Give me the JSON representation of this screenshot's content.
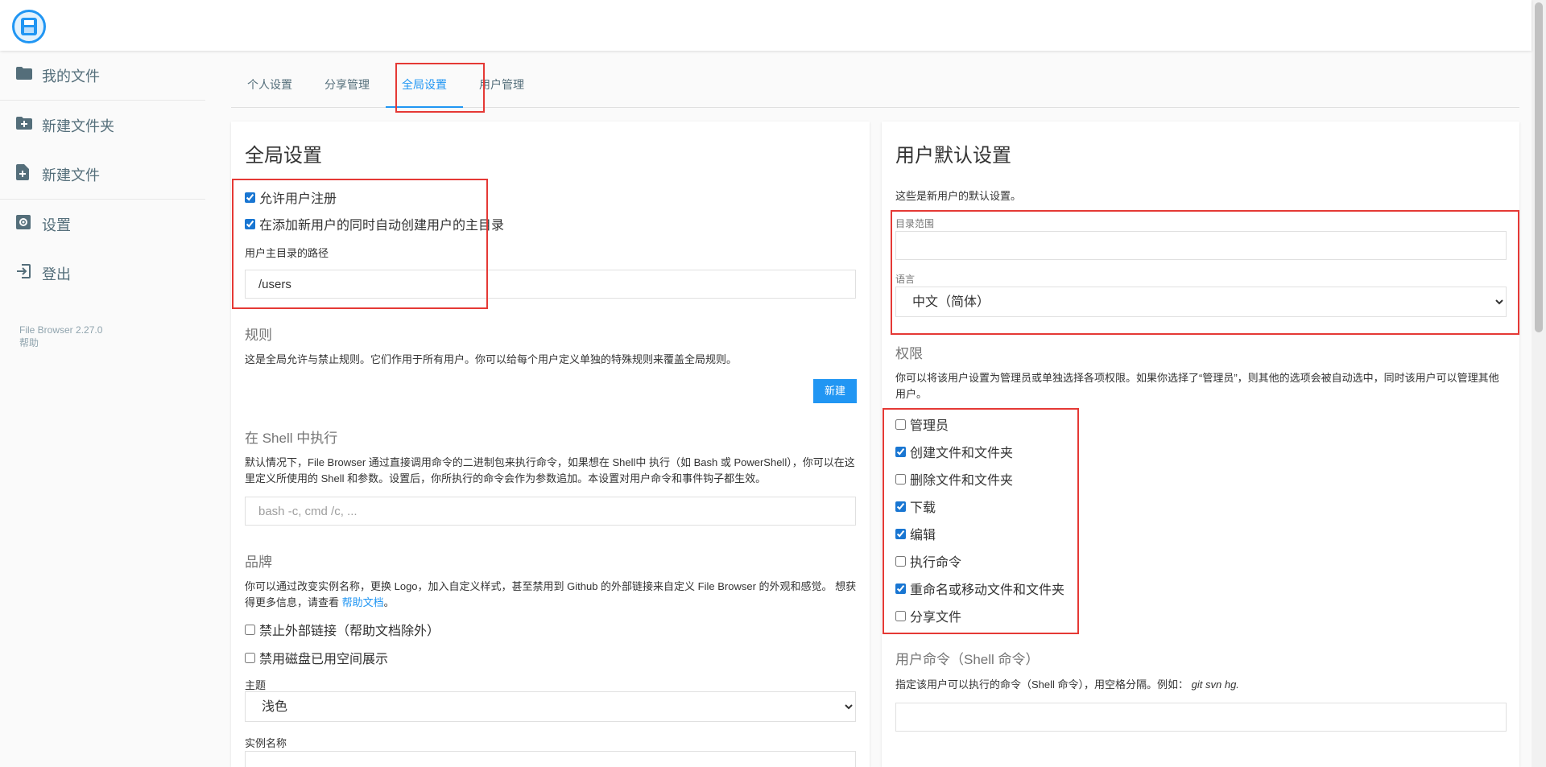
{
  "sidebar": {
    "items": [
      {
        "label": "我的文件",
        "icon": "folder-icon"
      },
      {
        "label": "新建文件夹",
        "icon": "folder-plus-icon"
      },
      {
        "label": "新建文件",
        "icon": "file-plus-icon"
      },
      {
        "label": "设置",
        "icon": "gear-icon"
      },
      {
        "label": "登出",
        "icon": "logout-icon"
      }
    ],
    "version": "File Browser 2.27.0",
    "help": "帮助"
  },
  "tabs": [
    {
      "label": "个人设置"
    },
    {
      "label": "分享管理"
    },
    {
      "label": "全局设置",
      "active": true
    },
    {
      "label": "用户管理"
    }
  ],
  "global": {
    "title": "全局设置",
    "allow_signup": "允许用户注册",
    "create_home": "在添加新用户的同时自动创建用户的主目录",
    "home_path_label": "用户主目录的路径",
    "home_path_value": "/users",
    "rules_title": "规则",
    "rules_desc": "这是全局允许与禁止规则。它们作用于所有用户。你可以给每个用户定义单独的特殊规则来覆盖全局规则。",
    "new_button": "新建",
    "shell_title": "在 Shell 中执行",
    "shell_desc": "默认情况下，File Browser 通过直接调用命令的二进制包来执行命令，如果想在 Shell中 执行（如 Bash 或 PowerShell），你可以在这里定义所使用的 Shell 和参数。设置后，你所执行的命令会作为参数追加。本设置对用户命令和事件钩子都生效。",
    "shell_placeholder": "bash -c, cmd /c, ...",
    "brand_title": "品牌",
    "brand_desc": "你可以通过改变实例名称，更换 Logo，加入自定义样式，甚至禁用到 Github 的外部链接来自定义 File Browser 的外观和感觉。 想获得更多信息，请查看",
    "brand_link": "帮助文档",
    "brand_desc_end": "。",
    "disable_links": "禁止外部链接（帮助文档除外）",
    "disable_usage": "禁用磁盘已用空间展示",
    "theme_label": "主题",
    "theme_value": "浅色",
    "instance_label": "实例名称"
  },
  "defaults": {
    "title": "用户默认设置",
    "desc": "这些是新用户的默认设置。",
    "scope_label": "目录范围",
    "scope_value": "",
    "lang_label": "语言",
    "lang_value": "中文（简体）",
    "perm_title": "权限",
    "perm_desc": "你可以将该用户设置为管理员或单独选择各项权限。如果你选择了“管理员”，则其他的选项会被自动选中，同时该用户可以管理其他用户。",
    "perms": [
      {
        "label": "管理员",
        "checked": false
      },
      {
        "label": "创建文件和文件夹",
        "checked": true
      },
      {
        "label": "删除文件和文件夹",
        "checked": false
      },
      {
        "label": "下载",
        "checked": true
      },
      {
        "label": "编辑",
        "checked": true
      },
      {
        "label": "执行命令",
        "checked": false
      },
      {
        "label": "重命名或移动文件和文件夹",
        "checked": true
      },
      {
        "label": "分享文件",
        "checked": false
      }
    ],
    "cmd_title": "用户命令（Shell 命令）",
    "cmd_desc": "指定该用户可以执行的命令（Shell 命令），用空格分隔。例如：",
    "cmd_example": "git svn hg."
  },
  "colors": {
    "accent": "#2196f3",
    "highlight": "#e53935"
  }
}
